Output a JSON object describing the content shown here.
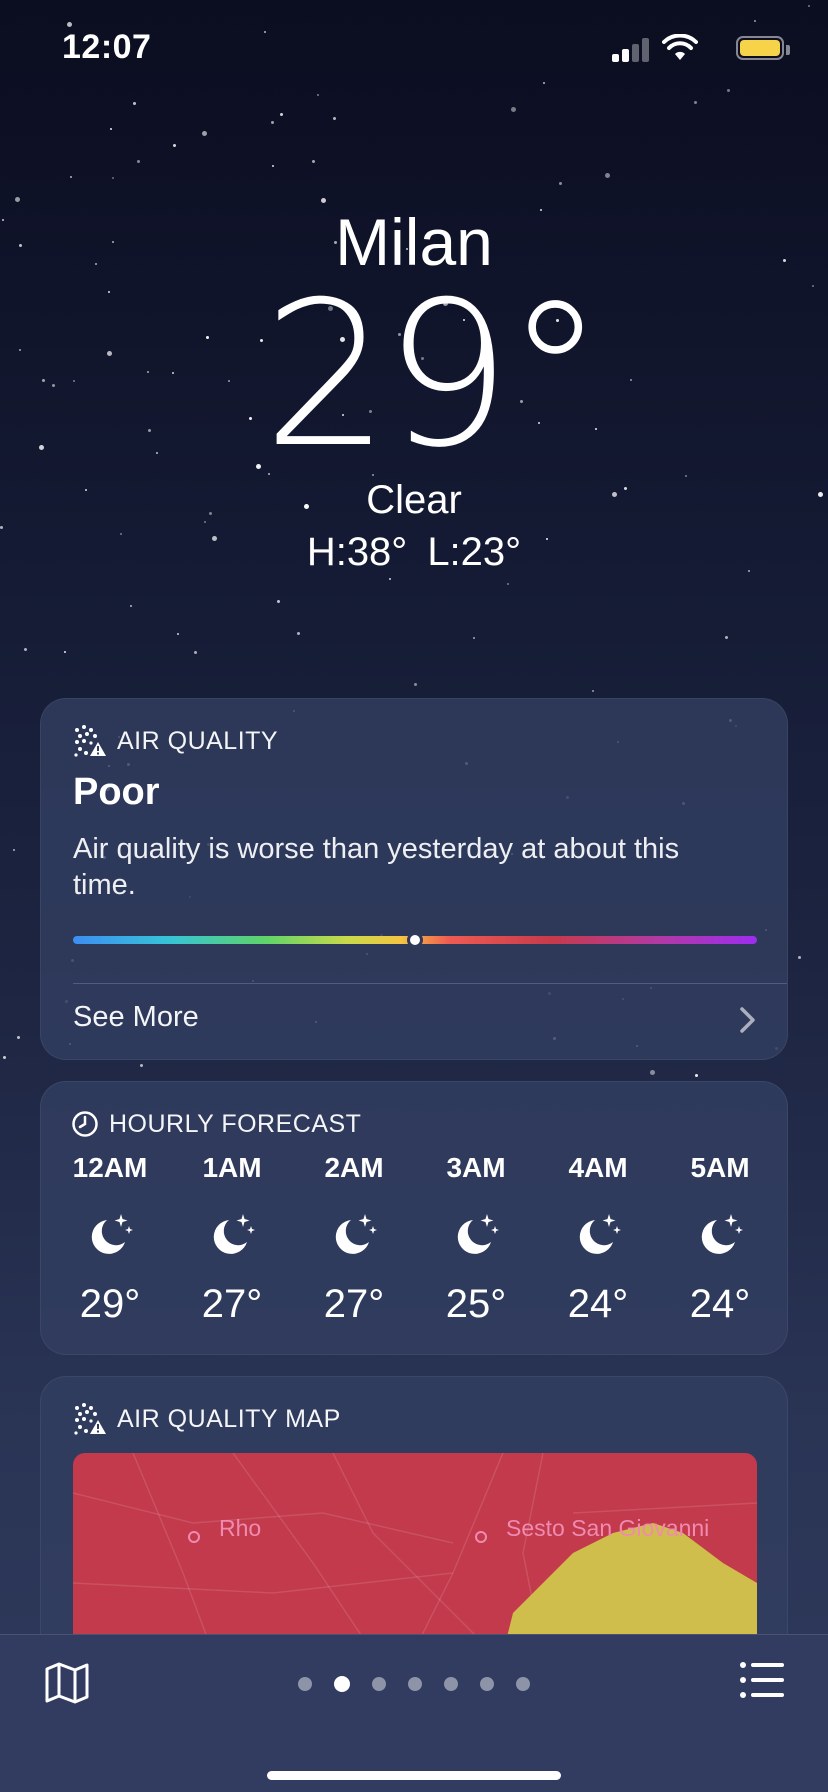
{
  "status_bar": {
    "time": "12:07"
  },
  "header": {
    "city": "Milan",
    "temperature": "29°",
    "condition": "Clear",
    "high": "H:38°",
    "low": "L:23°"
  },
  "air_quality": {
    "title": "AIR QUALITY",
    "level": "Poor",
    "description": "Air quality is worse than yesterday at about this time.",
    "scale_position": 0.5,
    "see_more": "See More"
  },
  "hourly_forecast": {
    "title": "HOURLY FORECAST",
    "hours": [
      {
        "time": "12AM",
        "icon": "moon-stars-icon",
        "temp": "29°"
      },
      {
        "time": "1AM",
        "icon": "moon-stars-icon",
        "temp": "27°"
      },
      {
        "time": "2AM",
        "icon": "moon-stars-icon",
        "temp": "27°"
      },
      {
        "time": "3AM",
        "icon": "moon-stars-icon",
        "temp": "25°"
      },
      {
        "time": "4AM",
        "icon": "moon-stars-icon",
        "temp": "24°"
      },
      {
        "time": "5AM",
        "icon": "moon-stars-icon",
        "temp": "24°"
      }
    ]
  },
  "air_quality_map": {
    "title": "AIR QUALITY MAP",
    "labels": {
      "rho": "Rho",
      "sesto": "Sesto San Giovanni"
    }
  },
  "toolbar": {
    "page_count": 7,
    "active_page": 1
  }
}
